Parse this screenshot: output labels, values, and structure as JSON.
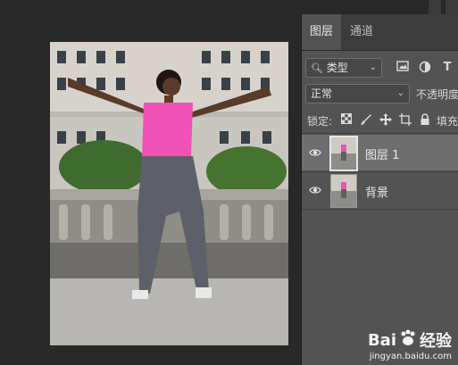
{
  "tabs": [
    {
      "label": "图层"
    },
    {
      "label": "通道"
    }
  ],
  "filter": {
    "kind": "类型"
  },
  "blend": {
    "mode": "正常",
    "opacity_label": "不透明度"
  },
  "lock": {
    "label": "锁定:",
    "fill_label": "填充"
  },
  "layers": [
    {
      "name": "图层 1"
    },
    {
      "name": "背景"
    }
  ],
  "watermark": {
    "brand": "Bai",
    "brand_cn": "经验",
    "url": "jingyan.baidu.com"
  }
}
